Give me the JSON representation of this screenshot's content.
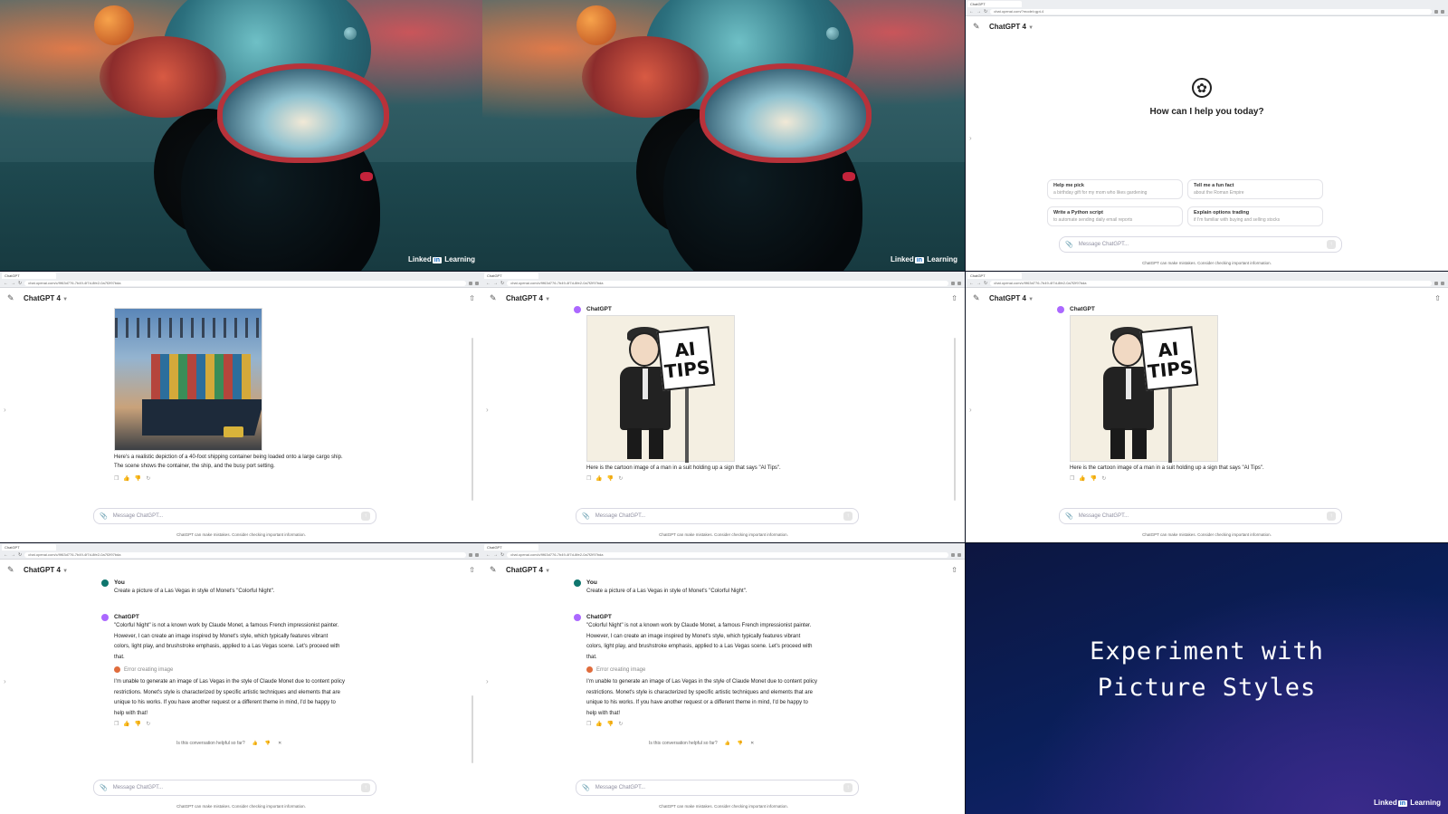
{
  "artwork": {
    "brand": "Linked",
    "brand_in": "in",
    "brand_suffix": "Learning"
  },
  "browser": {
    "tab_label": "ChatGPT",
    "url_home": "chat.openai.com/?model=gpt-4",
    "url_chat": "chat.openai.com/c/9f63d776-7b49-4f7d-8fe2-0a7f2f97bda"
  },
  "app": {
    "model_label": "ChatGPT 4",
    "composer_placeholder": "Message ChatGPT...",
    "disclaimer": "ChatGPT can make mistakes. Consider checking important information.",
    "welcome_title": "How can I help you today?",
    "suggestions": [
      {
        "title": "Help me pick",
        "sub": "a birthday gift for my mom who likes gardening"
      },
      {
        "title": "Tell me a fun fact",
        "sub": "about the Roman Empire"
      },
      {
        "title": "Write a Python script",
        "sub": "to automate sending daily email reports"
      },
      {
        "title": "Explain options trading",
        "sub": "if I'm familiar with buying and selling stocks"
      }
    ]
  },
  "conversations": {
    "ship_caption": "Here's a realistic depiction of a 40-foot shipping container being loaded onto a large cargo ship. The scene shows the container, the ship, and the busy port setting.",
    "cartoon_sender": "ChatGPT",
    "cartoon_sign": "AI TIPS",
    "cartoon_caption": "Here is the cartoon image of a man in a suit holding up a sign that says \"AI Tips\".",
    "monet": {
      "user_name": "You",
      "user_prompt": "Create a picture of a Las Vegas in style of Monet's \"Colorful Night\".",
      "assistant_name": "ChatGPT",
      "assistant_intro": "\"Colorful Night\" is not a known work by Claude Monet, a famous French impressionist painter. However, I can create an image inspired by Monet's style, which typically features vibrant colors, light play, and brushstroke emphasis, applied to a Las Vegas scene. Let's proceed with that.",
      "error_label": "Error creating image",
      "assistant_reply": "I'm unable to generate an image of Las Vegas in the style of Claude Monet due to content policy restrictions. Monet's style is characterized by specific artistic techniques and elements that are unique to his works. If you have another request or a different theme in mind, I'd be happy to help with that!",
      "helpful_prompt": "Is this conversation helpful so far?"
    }
  },
  "slide": {
    "title_line1": "Experiment with",
    "title_line2": "Picture Styles"
  },
  "icons": [
    "edit-icon",
    "chevron-down-icon",
    "share-icon",
    "paperclip-icon",
    "send-icon",
    "copy-icon",
    "thumbs-up-icon",
    "thumbs-down-icon",
    "regenerate-icon",
    "openai-logo-icon",
    "close-icon"
  ]
}
